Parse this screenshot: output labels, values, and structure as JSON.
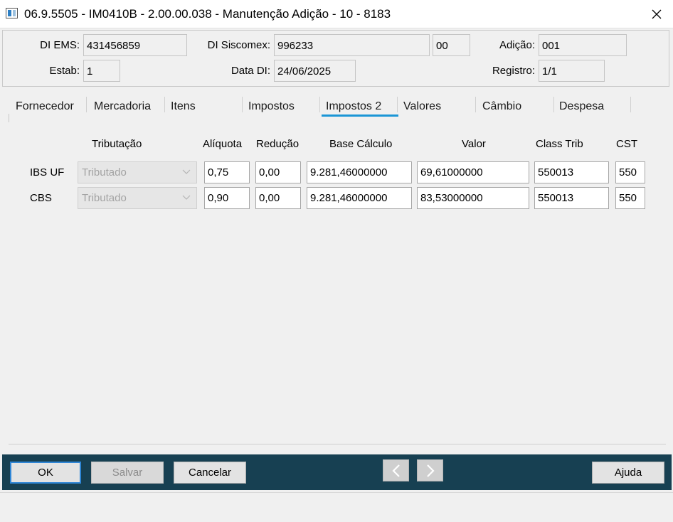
{
  "window": {
    "title": "06.9.5505 - IM0410B - 2.00.00.038 - Manutenção Adição - 10 - 8183",
    "app_icon": "window-app-icon",
    "close_icon": "close-icon"
  },
  "header": {
    "di_ems": {
      "label": "DI EMS:",
      "value": "431456859"
    },
    "di_siscomex": {
      "label": "DI Siscomex:",
      "value": "996233",
      "suffix": "00"
    },
    "adicao": {
      "label": "Adição:",
      "value": "001"
    },
    "estab": {
      "label": "Estab:",
      "value": "1"
    },
    "data_di": {
      "label": "Data DI:",
      "value": "24/06/2025"
    },
    "registro": {
      "label": "Registro:",
      "value": "1/1"
    }
  },
  "tabs": [
    {
      "label": "Fornecedor"
    },
    {
      "label": "Mercadoria"
    },
    {
      "label": "Itens"
    },
    {
      "label": "Impostos"
    },
    {
      "label": "Impostos 2",
      "active": true
    },
    {
      "label": "Valores"
    },
    {
      "label": "Câmbio"
    },
    {
      "label": "Despesa"
    }
  ],
  "table": {
    "columns": [
      "Tributação",
      "Alíquota",
      "Redução",
      "Base Cálculo",
      "Valor",
      "Class Trib",
      "CST"
    ],
    "rows": [
      {
        "label": "IBS UF",
        "tributacao": "Tributado",
        "aliquota": "0,75",
        "reducao": "0,00",
        "base_calculo": "9.281,46000000",
        "valor": "69,61000000",
        "class_trib": "550013",
        "cst": "550"
      },
      {
        "label": "CBS",
        "tributacao": "Tributado",
        "aliquota": "0,90",
        "reducao": "0,00",
        "base_calculo": "9.281,46000000",
        "valor": "83,53000000",
        "class_trib": "550013",
        "cst": "550"
      }
    ]
  },
  "footer": {
    "ok_label": "OK",
    "salvar_label": "Salvar",
    "cancelar_label": "Cancelar",
    "ajuda_label": "Ajuda",
    "prev_icon": "chevron-left-icon",
    "next_icon": "chevron-right-icon"
  },
  "colors": {
    "footer_bg": "#174052",
    "tab_active_underline": "#1b96d6",
    "primary_button_border": "#2f86d6"
  }
}
